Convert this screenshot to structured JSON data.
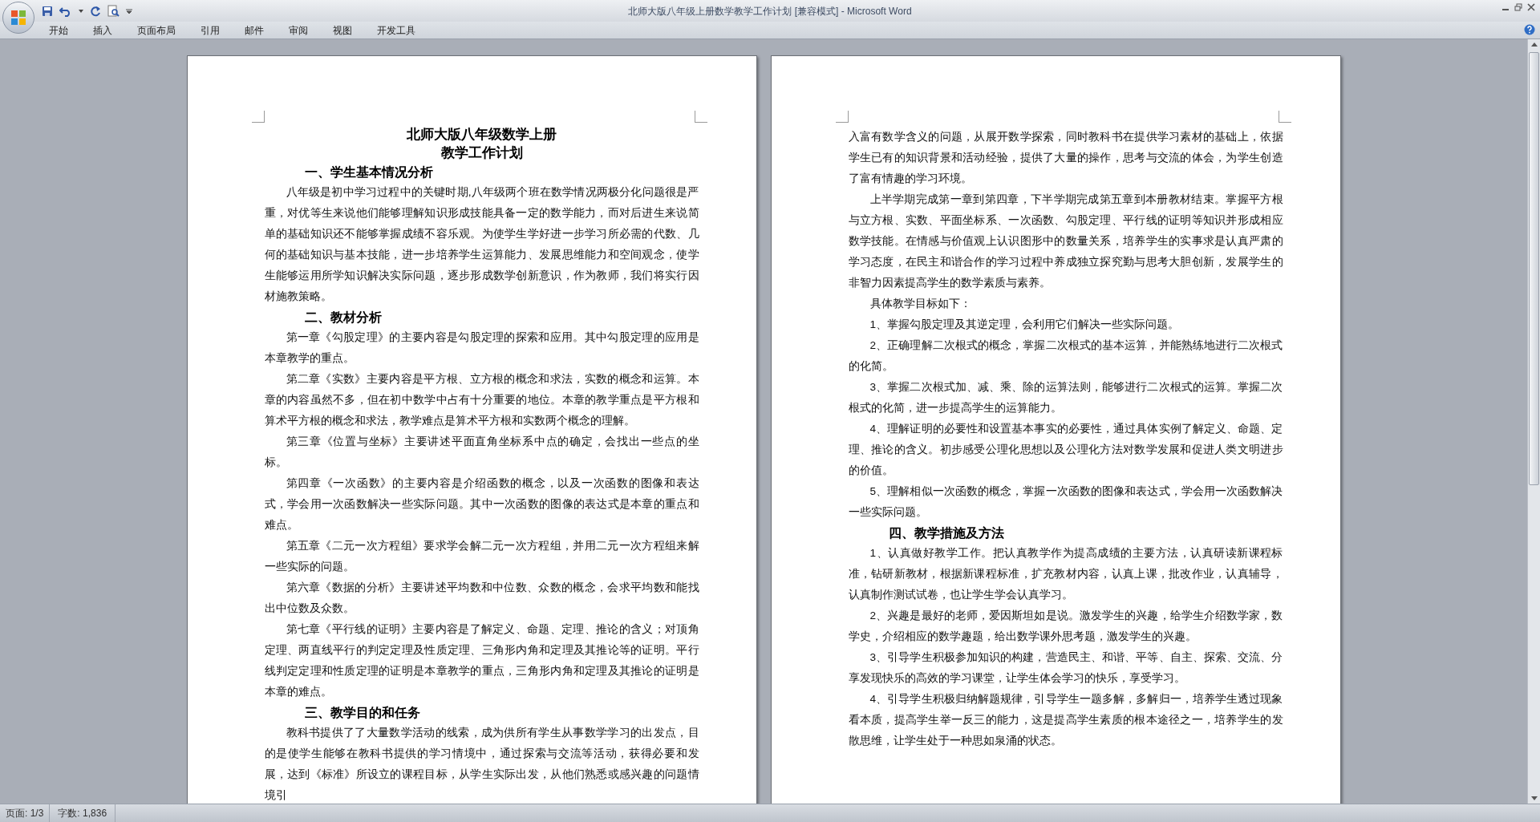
{
  "window": {
    "title": "北师大版八年级上册数学教学工作计划 [兼容模式] - Microsoft Word"
  },
  "ribbon_tabs": [
    {
      "label": "开始"
    },
    {
      "label": "插入"
    },
    {
      "label": "页面布局"
    },
    {
      "label": "引用"
    },
    {
      "label": "邮件"
    },
    {
      "label": "审阅"
    },
    {
      "label": "视图"
    },
    {
      "label": "开发工具"
    }
  ],
  "pages": [
    {
      "blocks": [
        {
          "kind": "title",
          "text": "北师大版八年级数学上册"
        },
        {
          "kind": "title",
          "text": "教学工作计划"
        },
        {
          "kind": "heading",
          "text": "一、学生基本情况分析"
        },
        {
          "kind": "paragraph",
          "text": "八年级是初中学习过程中的关键时期,八年级两个班在数学情况两极分化问题很是严重，对优等生来说他们能够理解知识形成技能具备一定的数学能力，而对后进生来说简单的基础知识还不能够掌握成绩不容乐观。为使学生学好进一步学习所必需的代数、几何的基础知识与基本技能，进一步培养学生运算能力、发展思维能力和空间观念，使学生能够运用所学知识解决实际问题，逐步形成数学创新意识，作为教师，我们将实行因材施教策略。"
        },
        {
          "kind": "heading",
          "text": "二、教材分析"
        },
        {
          "kind": "paragraph",
          "text": "第一章《勾股定理》的主要内容是勾股定理的探索和应用。其中勾股定理的应用是本章教学的重点。"
        },
        {
          "kind": "paragraph",
          "text": "第二章《实数》主要内容是平方根、立方根的概念和求法，实数的概念和运算。本章的内容虽然不多，但在初中数学中占有十分重要的地位。本章的教学重点是平方根和算术平方根的概念和求法，教学难点是算术平方根和实数两个概念的理解。"
        },
        {
          "kind": "paragraph",
          "text": "第三章《位置与坐标》主要讲述平面直角坐标系中点的确定，会找出一些点的坐标。"
        },
        {
          "kind": "paragraph",
          "text": "第四章《一次函数》的主要内容是介绍函数的概念，以及一次函数的图像和表达式，学会用一次函数解决一些实际问题。其中一次函数的图像的表达式是本章的重点和难点。"
        },
        {
          "kind": "paragraph",
          "text": "第五章《二元一次方程组》要求学会解二元一次方程组，并用二元一次方程组来解一些实际的问题。"
        },
        {
          "kind": "paragraph",
          "text": "第六章《数据的分析》主要讲述平均数和中位数、众数的概念，会求平均数和能找出中位数及众数。"
        },
        {
          "kind": "paragraph",
          "text": "第七章《平行线的证明》主要内容是了解定义、命题、定理、推论的含义；对顶角定理、两直线平行的判定定理及性质定理、三角形内角和定理及其推论等的证明。平行线判定定理和性质定理的证明是本章教学的重点，三角形内角和定理及其推论的证明是本章的难点。"
        },
        {
          "kind": "heading",
          "text": "三、教学目的和任务"
        },
        {
          "kind": "paragraph",
          "text": "教科书提供了了大量数学活动的线索，成为供所有学生从事数学学习的出发点，目的是使学生能够在教科书提供的学习情境中，通过探索与交流等活动，获得必要和发展，达到《标准》所设立的课程目标，从学生实际出发，从他们熟悉或感兴趣的问题情境引"
        }
      ]
    },
    {
      "blocks": [
        {
          "kind": "continuation",
          "text": "入富有数学含义的问题，从展开数学探索，同时教科书在提供学习素材的基础上，依据学生已有的知识背景和活动经验，提供了大量的操作，思考与交流的体会，为学生创造了富有情趣的学习环境。"
        },
        {
          "kind": "paragraph",
          "text": "上半学期完成第一章到第四章，下半学期完成第五章到本册教材结束。掌握平方根与立方根、实数、平面坐标系、一次函数、勾股定理、平行线的证明等知识并形成相应数学技能。在情感与价值观上认识图形中的数量关系，培养学生的实事求是认真严肃的学习态度，在民主和谐合作的学习过程中养成独立探究勤与思考大胆创新，发展学生的非智力因素提高学生的数学素质与素养。"
        },
        {
          "kind": "paragraph",
          "text": "具体教学目标如下："
        },
        {
          "kind": "paragraph",
          "text": "1、掌握勾股定理及其逆定理，会利用它们解决一些实际问题。"
        },
        {
          "kind": "paragraph",
          "text": "2、正确理解二次根式的概念，掌握二次根式的基本运算，并能熟练地进行二次根式的化简。"
        },
        {
          "kind": "paragraph",
          "text": "3、掌握二次根式加、减、乘、除的运算法则，能够进行二次根式的运算。掌握二次根式的化简，进一步提高学生的运算能力。"
        },
        {
          "kind": "paragraph",
          "text": "4、理解证明的必要性和设置基本事实的必要性，通过具体实例了解定义、命题、定理、推论的含义。初步感受公理化思想以及公理化方法对数学发展和促进人类文明进步的价值。"
        },
        {
          "kind": "paragraph",
          "text": "5、理解相似一次函数的概念，掌握一次函数的图像和表达式，学会用一次函数解决一些实际问题。"
        },
        {
          "kind": "heading",
          "text": "四、教学措施及方法"
        },
        {
          "kind": "paragraph",
          "text": "1、认真做好教学工作。把认真教学作为提高成绩的主要方法，认真研读新课程标准，钻研新教材，根据新课程标准，扩充教材内容，认真上课，批改作业，认真辅导，认真制作测试试卷，也让学生学会认真学习。"
        },
        {
          "kind": "paragraph",
          "text": "2、兴趣是最好的老师，爱因斯坦如是说。激发学生的兴趣，给学生介绍数学家，数学史，介绍相应的数学趣题，给出数学课外思考题，激发学生的兴趣。"
        },
        {
          "kind": "paragraph",
          "text": "3、引导学生积极参加知识的构建，营造民主、和谐、平等、自主、探索、交流、分享发现快乐的高效的学习课堂，让学生体会学习的快乐，享受学习。"
        },
        {
          "kind": "paragraph",
          "text": "4、引导学生积极归纳解题规律，引导学生一题多解，多解归一，培养学生透过现象看本质，提高学生举一反三的能力，这是提高学生素质的根本途径之一，培养学生的发散思维，让学生处于一种思如泉涌的状态。"
        }
      ]
    }
  ],
  "status_bar": {
    "page": "页面: 1/3",
    "words": "字数: 1,836"
  }
}
